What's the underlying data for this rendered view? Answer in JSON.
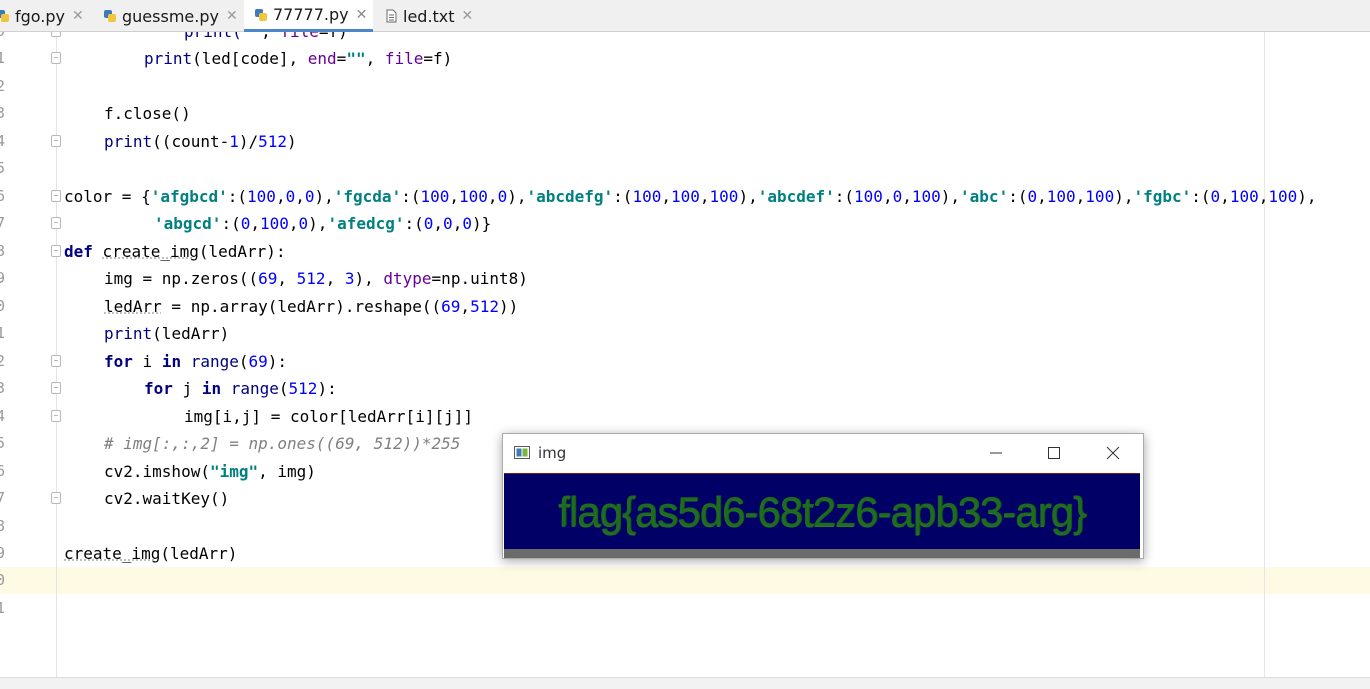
{
  "tabs": [
    {
      "label": "fgo.py",
      "active": false,
      "icon": "python-file-icon"
    },
    {
      "label": "guessme.py",
      "active": false,
      "icon": "python-file-icon"
    },
    {
      "label": "77777.py",
      "active": true,
      "icon": "python-file-icon"
    },
    {
      "label": "led.txt",
      "active": false,
      "icon": "text-file-icon"
    }
  ],
  "line_numbers": [
    "0",
    "1",
    "2",
    "3",
    "4",
    "5",
    "6",
    "7",
    "8",
    "9",
    "0",
    "1",
    "2",
    "3",
    "4",
    "5",
    "6",
    "7",
    "8",
    "9",
    "0",
    "1"
  ],
  "code": {
    "l00_a": "print(",
    "l00_b": "\"\"",
    "l00_c": ", ",
    "l00_d": "file",
    "l00_e": "=f)",
    "l01_a": "print",
    "l01_b": "(led[code], ",
    "l01_c": "end",
    "l01_d": "=",
    "l01_e": "\"\"",
    "l01_f": ", ",
    "l01_g": "file",
    "l01_h": "=f)",
    "l03": "f.close()",
    "l04_a": "print",
    "l04_b": "((count-",
    "l04_c": "1",
    "l04_d": ")/",
    "l04_e": "512",
    "l04_f": ")",
    "l06_a": "color = {",
    "l06_s1": "'afgbcd'",
    "l06_v1a": ":(",
    "l06_n1": [
      "100",
      "0",
      "0"
    ],
    "l06_s2": "'fgcda'",
    "l06_n2": [
      "100",
      "100",
      "0"
    ],
    "l06_s3": "'abcdefg'",
    "l06_n3": [
      "100",
      "100",
      "100"
    ],
    "l06_s4": "'abcdef'",
    "l06_n4": [
      "100",
      "0",
      "100"
    ],
    "l06_s5": "'abc'",
    "l06_n5": [
      "0",
      "100",
      "100"
    ],
    "l06_s6": "'fgbc'",
    "l06_n6": [
      "0",
      "100",
      "100"
    ],
    "l07_s1": "'abgcd'",
    "l07_n1": [
      "0",
      "100",
      "0"
    ],
    "l07_s2": "'afedcg'",
    "l07_n2": [
      "0",
      "0",
      "0"
    ],
    "l08_kw": "def",
    "l08_name": "create_img",
    "l08_rest": "(ledArr):",
    "l09_a": "img = np.zeros((",
    "l09_n1": "69",
    "l09_n2": "512",
    "l09_n3": "3",
    "l09_kwarg": "dtype",
    "l09_e": "=np.uint8)",
    "l10_a": "ledArr",
    "l10_b": " = np.array(ledArr).reshape((",
    "l10_n1": "69",
    "l10_n2": "512",
    "l10_c": "))",
    "l11_a": "print",
    "l11_b": "(ledArr)",
    "l12_kw1": "for",
    "l12_b": " i ",
    "l12_kw2": "in",
    "l12_bi": "range",
    "l12_n": "69",
    "l13_kw1": "for",
    "l13_b": " j ",
    "l13_kw2": "in",
    "l13_bi": "range",
    "l13_n": "512",
    "l14": "img[i,j] = color[ledArr[i][j]]",
    "l15": "# img[:,:,2] = np.ones((69, 512))*255",
    "l16_a": "cv2.imshow(",
    "l16_s": "\"img\"",
    "l16_b": ", img)",
    "l17": "cv2.waitKey()",
    "l19_name": "create_img",
    "l19_rest": "(ledArr)"
  },
  "img_window": {
    "title": "img",
    "flag_text": "flag{as5d6-68t2z6-apb33-arg}",
    "controls": [
      "minimize-icon",
      "maximize-icon",
      "close-icon"
    ]
  },
  "colors": {
    "keyword": "#000080",
    "string": "#008080",
    "number": "#0000ff",
    "comment": "#808080",
    "kwarg": "#660099",
    "image_background": "#000066",
    "flag_text": "#1f6b1f",
    "active_tab_underline": "#4a87c7",
    "caret_row": "#fffae3"
  }
}
